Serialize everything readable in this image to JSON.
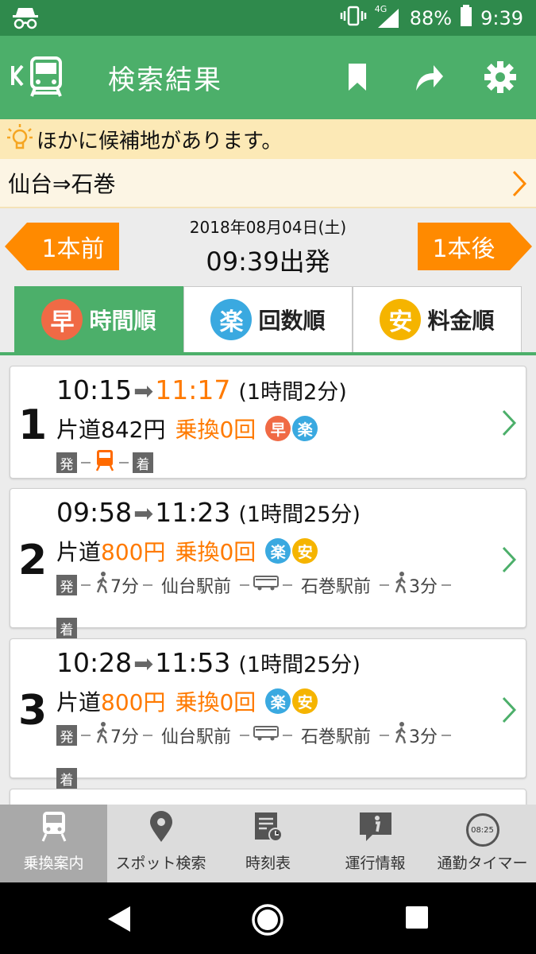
{
  "status_bar": {
    "network": "4G",
    "battery": "88%",
    "time": "9:39"
  },
  "app_bar": {
    "title": "検索結果"
  },
  "notice": {
    "text": "ほかに候補地があります。"
  },
  "route": {
    "text": "仙台⇒石巻"
  },
  "date_nav": {
    "prev_label": "1本前",
    "next_label": "1本後",
    "date": "2018年08月04日(土)",
    "departure": "09:39出発"
  },
  "sort_tabs": [
    {
      "badge": "早",
      "label": "時間順",
      "color": "#f06a45",
      "active": true
    },
    {
      "badge": "楽",
      "label": "回数順",
      "color": "#3aa9e0",
      "active": false
    },
    {
      "badge": "安",
      "label": "料金順",
      "color": "#f5b400",
      "active": false
    }
  ],
  "results": [
    {
      "number": "1",
      "depart": "10:15",
      "arrive": "11:17",
      "arrive_highlight": true,
      "duration": "(1時間2分)",
      "fare_prefix": "片道",
      "fare": "842円",
      "fare_highlight": false,
      "transfers": "乗換0回",
      "badges": [
        "早",
        "楽"
      ],
      "depart_mark": "発",
      "arrive_mark": "着"
    },
    {
      "number": "2",
      "depart": "09:58",
      "arrive": "11:23",
      "arrive_highlight": false,
      "duration": "(1時間25分)",
      "fare_prefix": "片道",
      "fare": "800円",
      "fare_highlight": true,
      "transfers": "乗換0回",
      "badges": [
        "楽",
        "安"
      ],
      "depart_mark": "発",
      "arrive_mark": "着",
      "walk1": "7分",
      "stop1": "仙台駅前",
      "stop2": "石巻駅前",
      "walk2": "3分"
    },
    {
      "number": "3",
      "depart": "10:28",
      "arrive": "11:53",
      "arrive_highlight": false,
      "duration": "(1時間25分)",
      "fare_prefix": "片道",
      "fare": "800円",
      "fare_highlight": true,
      "transfers": "乗換0回",
      "badges": [
        "楽",
        "安"
      ],
      "depart_mark": "発",
      "arrive_mark": "着",
      "walk1": "7分",
      "stop1": "仙台駅前",
      "stop2": "石巻駅前",
      "walk2": "3分"
    }
  ],
  "bottom_nav": [
    {
      "label": "乗換案内",
      "active": true
    },
    {
      "label": "スポット検索",
      "active": false
    },
    {
      "label": "時刻表",
      "active": false
    },
    {
      "label": "運行情報",
      "active": false
    },
    {
      "label": "通勤タイマー",
      "active": false,
      "icon_text": "08:25"
    }
  ],
  "colors": {
    "green": "#4caf6a",
    "dark_green": "#2f8a4c",
    "orange": "#ff7a00",
    "notice_bg": "#fce9b6"
  }
}
